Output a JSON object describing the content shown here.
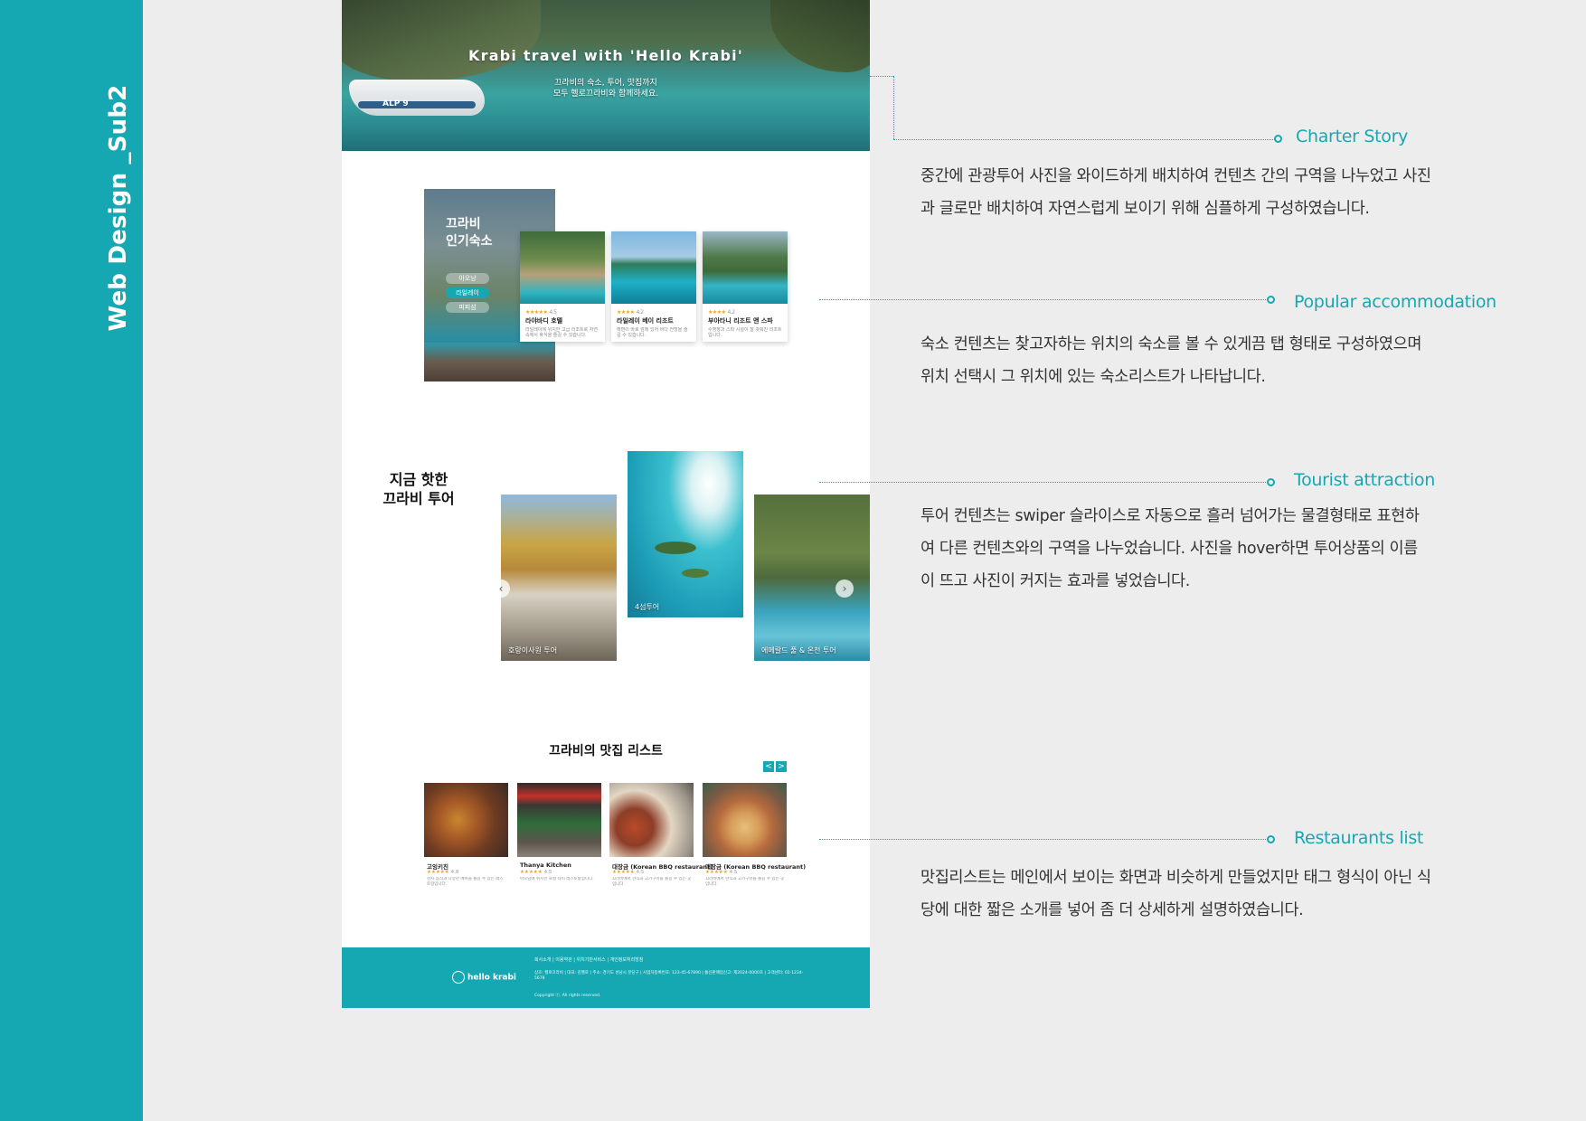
{
  "sidebar": {
    "title": "Web Design _Sub2"
  },
  "page": {
    "hero": {
      "title": "Krabi travel with 'Hello Krabi'",
      "subtitle_1": "끄라비의 숙소, 투어, 맛집까지",
      "subtitle_2": "모두 헬로끄라비와 함께하세요.",
      "boat_label": "ALP 9"
    },
    "accommodation": {
      "title_1": "끄라비",
      "title_2": "인기숙소",
      "tabs": [
        "아오낭",
        "라일레이",
        "피피섬"
      ],
      "active_tab": "라일레이",
      "cards": [
        {
          "stars": "★★★★★",
          "rating": "4.5",
          "name": "라야바디 호텔",
          "desc": "라일레이에 위치한 고급 리조트로 자연 속에서 휴식을 즐길 수 있습니다."
        },
        {
          "stars": "★★★★",
          "rating": "4.2",
          "name": "라일레이 베이 리조트",
          "desc": "해변이 바로 앞에 있어 바다 전망을 즐길 수 있습니다."
        },
        {
          "stars": "★★★★",
          "rating": "4.2",
          "name": "부아타니 리조트 앤 스파",
          "desc": "수영장과 스파 시설이 잘 갖춰진 리조트입니다."
        }
      ]
    },
    "tours": {
      "heading_1": "지금 핫한",
      "heading_2": "끄라비 투어",
      "cards": [
        {
          "label": "호랑이사원 투어"
        },
        {
          "label": "4섬투어"
        },
        {
          "label": "에메랄드 풀 & 온천 투어"
        }
      ],
      "prev_icon": "‹",
      "next_icon": "›"
    },
    "restaurants": {
      "heading": "끄라비의 맛집 리스트",
      "prev_icon": "<",
      "next_icon": ">",
      "cards": [
        {
          "name": "고잉키친",
          "stars": "★★★★★",
          "rating": "4.8",
          "desc": "현지 음식과 다양한 메뉴를 즐길 수 있는 레스토랑입니다."
        },
        {
          "name": "Thanya Kitchen",
          "stars": "★★★★★",
          "rating": "4.5",
          "desc": "아오낭에 위치한 로컬 타이 레스토랑입니다."
        },
        {
          "name": "대장금 (Korean BBQ restaurant)",
          "stars": "★★★★★",
          "rating": "4.5",
          "desc": "끄라비에서 한식과 고기구이를 즐길 수 있는 곳입니다."
        },
        {
          "name": "대장금 (Korean BBQ restaurant)",
          "stars": "★★★★★",
          "rating": "4.5",
          "desc": "끄라비에서 한식과 고기구이를 즐길 수 있는 곳입니다."
        }
      ]
    },
    "footer": {
      "logo": "hello krabi",
      "links": "회사소개 | 이용약관 | 위치기반서비스 | 개인정보처리방침",
      "info": "상호: 헬로끄라비 | 대표: 김헬로 | 주소: 경기도 성남시 분당구 | 사업자등록번호: 123-45-67890 | 통신판매업신고: 제2024-0000호 | 고객센터: 02-1234-5678",
      "copyright": "Copyright ⓒ. All rights reserved."
    }
  },
  "annotations": [
    {
      "title": "Charter Story",
      "desc": "중간에 관광투어 사진을 와이드하게 배치하여 컨텐츠 간의 구역을 나누었고 사진과 글로만 배치하여 자연스럽게  보이기 위해 심플하게 구성하였습니다."
    },
    {
      "title": "Popular accommodation",
      "desc": "숙소  컨텐츠는 찾고자하는 위치의 숙소를 볼 수 있게끔 탭 형태로 구성하였으며 위치 선택시 그 위치에 있는 숙소리스트가 나타납니다."
    },
    {
      "title": "Tourist attraction",
      "desc": "투어 컨텐츠는 swiper 슬라이스로 자동으로 흘러 넘어가는 물결형태로 표현하여 다른 컨텐츠와의 구역을 나누었습니다.  사진을  hover하면 투어상품의 이름이 뜨고 사진이 커지는 효과를 넣었습니다."
    },
    {
      "title": "Restaurants list",
      "desc": "맛집리스트는 메인에서 보이는 화면과 비슷하게 만들었지만 태그 형식이 아닌 식당에 대한 짧은 소개를 넣어 좀  더 상세하게 설명하였습니다."
    }
  ],
  "colors": {
    "accent": "#16a8b2",
    "background": "#ededed",
    "page": "#ffffff"
  }
}
